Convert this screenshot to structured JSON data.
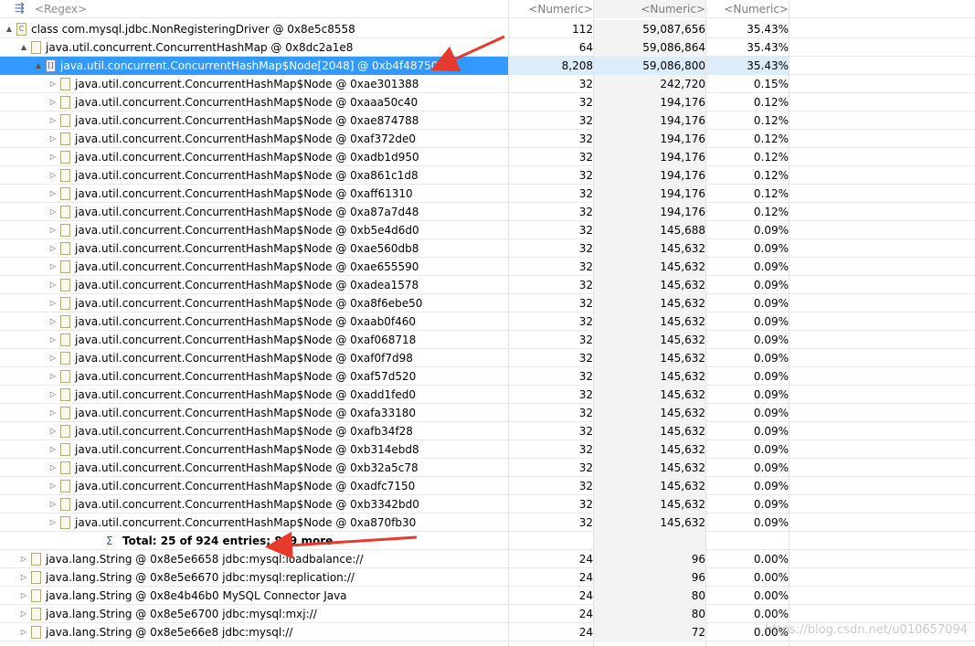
{
  "header": {
    "regex": "<Regex>",
    "col1": "<Numeric>",
    "col2": "<Numeric>",
    "col3": "<Numeric>"
  },
  "rows": [
    {
      "kind": "node",
      "indent": 0,
      "tw": "▲",
      "icon": "C",
      "label": "class com.mysql.jdbc.NonRegisteringDriver @ 0x8e5c8558",
      "v1": "112",
      "v2": "59,087,656",
      "v3": "35.43%"
    },
    {
      "kind": "node",
      "indent": 1,
      "tw": "▲",
      "icon": "",
      "label": "java.util.concurrent.ConcurrentHashMap @ 0x8dc2a1e8",
      "v1": "64",
      "v2": "59,086,864",
      "v3": "35.43%"
    },
    {
      "kind": "node",
      "indent": 2,
      "tw": "▲",
      "icon": "[]",
      "label": "java.util.concurrent.ConcurrentHashMap$Node[2048] @ 0xb4f48750",
      "v1": "8,208",
      "v2": "59,086,800",
      "v3": "35.43%",
      "selected": true
    },
    {
      "kind": "node",
      "indent": 3,
      "tw": "▷",
      "icon": "",
      "label": "java.util.concurrent.ConcurrentHashMap$Node @ 0xae301388",
      "v1": "32",
      "v2": "242,720",
      "v3": "0.15%"
    },
    {
      "kind": "node",
      "indent": 3,
      "tw": "▷",
      "icon": "",
      "label": "java.util.concurrent.ConcurrentHashMap$Node @ 0xaaa50c40",
      "v1": "32",
      "v2": "194,176",
      "v3": "0.12%"
    },
    {
      "kind": "node",
      "indent": 3,
      "tw": "▷",
      "icon": "",
      "label": "java.util.concurrent.ConcurrentHashMap$Node @ 0xae874788",
      "v1": "32",
      "v2": "194,176",
      "v3": "0.12%"
    },
    {
      "kind": "node",
      "indent": 3,
      "tw": "▷",
      "icon": "",
      "label": "java.util.concurrent.ConcurrentHashMap$Node @ 0xaf372de0",
      "v1": "32",
      "v2": "194,176",
      "v3": "0.12%"
    },
    {
      "kind": "node",
      "indent": 3,
      "tw": "▷",
      "icon": "",
      "label": "java.util.concurrent.ConcurrentHashMap$Node @ 0xadb1d950",
      "v1": "32",
      "v2": "194,176",
      "v3": "0.12%"
    },
    {
      "kind": "node",
      "indent": 3,
      "tw": "▷",
      "icon": "",
      "label": "java.util.concurrent.ConcurrentHashMap$Node @ 0xa861c1d8",
      "v1": "32",
      "v2": "194,176",
      "v3": "0.12%"
    },
    {
      "kind": "node",
      "indent": 3,
      "tw": "▷",
      "icon": "",
      "label": "java.util.concurrent.ConcurrentHashMap$Node @ 0xaff61310",
      "v1": "32",
      "v2": "194,176",
      "v3": "0.12%"
    },
    {
      "kind": "node",
      "indent": 3,
      "tw": "▷",
      "icon": "",
      "label": "java.util.concurrent.ConcurrentHashMap$Node @ 0xa87a7d48",
      "v1": "32",
      "v2": "194,176",
      "v3": "0.12%"
    },
    {
      "kind": "node",
      "indent": 3,
      "tw": "▷",
      "icon": "",
      "label": "java.util.concurrent.ConcurrentHashMap$Node @ 0xb5e4d6d0",
      "v1": "32",
      "v2": "145,688",
      "v3": "0.09%"
    },
    {
      "kind": "node",
      "indent": 3,
      "tw": "▷",
      "icon": "",
      "label": "java.util.concurrent.ConcurrentHashMap$Node @ 0xae560db8",
      "v1": "32",
      "v2": "145,632",
      "v3": "0.09%"
    },
    {
      "kind": "node",
      "indent": 3,
      "tw": "▷",
      "icon": "",
      "label": "java.util.concurrent.ConcurrentHashMap$Node @ 0xae655590",
      "v1": "32",
      "v2": "145,632",
      "v3": "0.09%"
    },
    {
      "kind": "node",
      "indent": 3,
      "tw": "▷",
      "icon": "",
      "label": "java.util.concurrent.ConcurrentHashMap$Node @ 0xadea1578",
      "v1": "32",
      "v2": "145,632",
      "v3": "0.09%"
    },
    {
      "kind": "node",
      "indent": 3,
      "tw": "▷",
      "icon": "",
      "label": "java.util.concurrent.ConcurrentHashMap$Node @ 0xa8f6ebe50",
      "v1": "32",
      "v2": "145,632",
      "v3": "0.09%"
    },
    {
      "kind": "node",
      "indent": 3,
      "tw": "▷",
      "icon": "",
      "label": "java.util.concurrent.ConcurrentHashMap$Node @ 0xaab0f460",
      "v1": "32",
      "v2": "145,632",
      "v3": "0.09%"
    },
    {
      "kind": "node",
      "indent": 3,
      "tw": "▷",
      "icon": "",
      "label": "java.util.concurrent.ConcurrentHashMap$Node @ 0xaf068718",
      "v1": "32",
      "v2": "145,632",
      "v3": "0.09%"
    },
    {
      "kind": "node",
      "indent": 3,
      "tw": "▷",
      "icon": "",
      "label": "java.util.concurrent.ConcurrentHashMap$Node @ 0xaf0f7d98",
      "v1": "32",
      "v2": "145,632",
      "v3": "0.09%"
    },
    {
      "kind": "node",
      "indent": 3,
      "tw": "▷",
      "icon": "",
      "label": "java.util.concurrent.ConcurrentHashMap$Node @ 0xaf57d520",
      "v1": "32",
      "v2": "145,632",
      "v3": "0.09%"
    },
    {
      "kind": "node",
      "indent": 3,
      "tw": "▷",
      "icon": "",
      "label": "java.util.concurrent.ConcurrentHashMap$Node @ 0xadd1fed0",
      "v1": "32",
      "v2": "145,632",
      "v3": "0.09%"
    },
    {
      "kind": "node",
      "indent": 3,
      "tw": "▷",
      "icon": "",
      "label": "java.util.concurrent.ConcurrentHashMap$Node @ 0xafa33180",
      "v1": "32",
      "v2": "145,632",
      "v3": "0.09%"
    },
    {
      "kind": "node",
      "indent": 3,
      "tw": "▷",
      "icon": "",
      "label": "java.util.concurrent.ConcurrentHashMap$Node @ 0xafb34f28",
      "v1": "32",
      "v2": "145,632",
      "v3": "0.09%"
    },
    {
      "kind": "node",
      "indent": 3,
      "tw": "▷",
      "icon": "",
      "label": "java.util.concurrent.ConcurrentHashMap$Node @ 0xb314ebd8",
      "v1": "32",
      "v2": "145,632",
      "v3": "0.09%"
    },
    {
      "kind": "node",
      "indent": 3,
      "tw": "▷",
      "icon": "",
      "label": "java.util.concurrent.ConcurrentHashMap$Node @ 0xb32a5c78",
      "v1": "32",
      "v2": "145,632",
      "v3": "0.09%"
    },
    {
      "kind": "node",
      "indent": 3,
      "tw": "▷",
      "icon": "",
      "label": "java.util.concurrent.ConcurrentHashMap$Node @ 0xadfc7150",
      "v1": "32",
      "v2": "145,632",
      "v3": "0.09%"
    },
    {
      "kind": "node",
      "indent": 3,
      "tw": "▷",
      "icon": "",
      "label": "java.util.concurrent.ConcurrentHashMap$Node @ 0xb3342bd0",
      "v1": "32",
      "v2": "145,632",
      "v3": "0.09%"
    },
    {
      "kind": "node",
      "indent": 3,
      "tw": "▷",
      "icon": "",
      "label": "java.util.concurrent.ConcurrentHashMap$Node @ 0xa870fb30",
      "v1": "32",
      "v2": "145,632",
      "v3": "0.09%"
    },
    {
      "kind": "total",
      "indent": 3,
      "label": "Total: 25 of 924 entries; 899 more",
      "v1": "",
      "v2": "",
      "v3": ""
    },
    {
      "kind": "node",
      "indent": 1,
      "tw": "▷",
      "icon": "",
      "label": "java.lang.String @ 0x8e5e6658  jdbc:mysql:loadbalance://",
      "v1": "24",
      "v2": "96",
      "v3": "0.00%"
    },
    {
      "kind": "node",
      "indent": 1,
      "tw": "▷",
      "icon": "",
      "label": "java.lang.String @ 0x8e5e6670  jdbc:mysql:replication://",
      "v1": "24",
      "v2": "96",
      "v3": "0.00%"
    },
    {
      "kind": "node",
      "indent": 1,
      "tw": "▷",
      "icon": "",
      "label": "java.lang.String @ 0x8e4b46b0  MySQL Connector Java",
      "v1": "24",
      "v2": "80",
      "v3": "0.00%"
    },
    {
      "kind": "node",
      "indent": 1,
      "tw": "▷",
      "icon": "",
      "label": "java.lang.String @ 0x8e5e6700  jdbc:mysql:mxj://",
      "v1": "24",
      "v2": "80",
      "v3": "0.00%"
    },
    {
      "kind": "node",
      "indent": 1,
      "tw": "▷",
      "icon": "",
      "label": "java.lang.String @ 0x8e5e66e8  jdbc:mysql://",
      "v1": "24",
      "v2": "72",
      "v3": "0.00%"
    }
  ],
  "watermark": "https://blog.csdn.net/u010657094",
  "colors": {
    "selection": "#3399ff",
    "arrow": "#e53a2c"
  }
}
